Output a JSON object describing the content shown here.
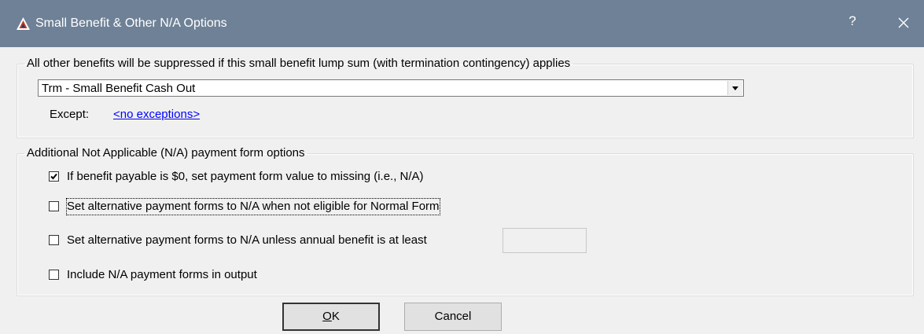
{
  "window": {
    "title": "Small Benefit & Other N/A Options",
    "help_label": "?",
    "titlebar_color": "#6e8196"
  },
  "group_lump_sum": {
    "legend": "All other benefits will be suppressed if this small benefit lump sum (with termination contingency) applies",
    "combo_value": "Trm - Small Benefit Cash Out",
    "except_label": "Except:",
    "except_link": "<no exceptions>"
  },
  "group_na": {
    "legend": "Additional Not Applicable (N/A) payment form options",
    "options": [
      {
        "label": "If benefit payable is $0, set payment form value to missing (i.e., N/A)",
        "checked": true
      },
      {
        "label": "Set alternative payment forms to N/A when not eligible for Normal Form",
        "checked": false
      },
      {
        "label": "Set alternative payment forms to N/A unless annual benefit is at least",
        "checked": false
      },
      {
        "label": "Include N/A payment forms in output",
        "checked": false
      }
    ],
    "minimum_benefit_value": ""
  },
  "buttons": {
    "ok_mnemonic": "O",
    "ok_rest": "K",
    "cancel_label": "Cancel"
  },
  "icons": {
    "app": "app-logo-icon",
    "close": "close-icon",
    "dropdown": "chevron-down-icon",
    "check": "checkmark-icon"
  },
  "colors": {
    "link": "#0000ff",
    "background": "#f0f0f0"
  }
}
